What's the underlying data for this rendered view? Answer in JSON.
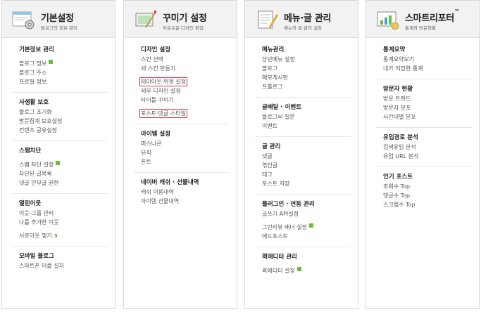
{
  "columns": [
    {
      "title": "기본설정",
      "subtitle": "블로그의 정보 관리",
      "icon": "gear-window-icon",
      "sections": [
        {
          "title": "기본정보 관리",
          "items": [
            {
              "label": "블로그 정보",
              "badge": "new"
            },
            {
              "label": "블로그 주소"
            },
            {
              "label": "프로필 정보"
            }
          ]
        },
        {
          "title": "사생활 보호",
          "items": [
            {
              "label": "블로그 초기화"
            },
            {
              "label": "방문집계 보호설정"
            },
            {
              "label": "컨텐츠 공유설정"
            }
          ]
        },
        {
          "title": "스팸차단",
          "items": [
            {
              "label": "스팸 차단 설정",
              "badge": "new"
            },
            {
              "label": "차단된 글목록"
            },
            {
              "label": "댓글 안부글 권한"
            }
          ]
        },
        {
          "title": "열린이웃",
          "items": [
            {
              "label": "이웃·그룹 관리"
            },
            {
              "label": "나를 추가한 이웃"
            },
            {
              "label": "서로이웃 맺기",
              "count": "3"
            }
          ]
        },
        {
          "title": "모바일 블로그",
          "items": [
            {
              "label": "스마트폰 어플 설치"
            }
          ]
        }
      ]
    },
    {
      "title": "꾸미기 설정",
      "subtitle": "자유로운 디자인 편집",
      "icon": "paint-canvas-icon",
      "sections": [
        {
          "title": "디자인 설정",
          "items": [
            {
              "label": "스킨 선택"
            },
            {
              "label": "새 스킨 만들기"
            },
            {
              "label": "레이아웃·위젯 설정",
              "highlight": true
            },
            {
              "label": "세부 디자인 설정"
            },
            {
              "label": "타이틀 꾸미기"
            },
            {
              "label": "포스트·댓글 스타일",
              "highlight": true
            }
          ]
        },
        {
          "title": "아이템 설정",
          "items": [
            {
              "label": "퍼스나콘"
            },
            {
              "label": "뮤직"
            },
            {
              "label": "폰트"
            }
          ]
        },
        {
          "title": "네이버 캐쉬 · 선물내역",
          "items": [
            {
              "label": "캐쉬 이용내역"
            },
            {
              "label": "아이템 선물내역"
            }
          ]
        }
      ]
    },
    {
      "title": "메뉴·글 관리",
      "subtitle": "메뉴와 글 관리 설정",
      "icon": "notepad-pencil-icon",
      "sections": [
        {
          "title": "메뉴관리",
          "items": [
            {
              "label": "상단메뉴 설정"
            },
            {
              "label": "블로그"
            },
            {
              "label": "메모게시판"
            },
            {
              "label": "프롤로그"
            }
          ]
        },
        {
          "title": "글배달 · 이벤트",
          "items": [
            {
              "label": "블로그씨 질문"
            },
            {
              "label": "이벤트"
            }
          ]
        },
        {
          "title": "글 관리",
          "items": [
            {
              "label": "댓글"
            },
            {
              "label": "엮인글"
            },
            {
              "label": "태그"
            },
            {
              "label": "포스트 저장"
            }
          ]
        },
        {
          "title": "플러그인 · 연동 관리",
          "items": [
            {
              "label": "글쓰기 API설정"
            },
            {
              "label": "그린리뷰 배너 설정",
              "badge": "new"
            },
            {
              "label": "애드포스트"
            }
          ]
        },
        {
          "title": "퀵에디터 관리",
          "items": [
            {
              "label": "퀵에디터 설정",
              "badge": "new"
            }
          ]
        }
      ]
    },
    {
      "title": "스마트리포터",
      "title_mark": "™",
      "subtitle": "통계와 방문현황",
      "icon": "chart-board-icon",
      "sections": [
        {
          "title": "통계요약",
          "items": [
            {
              "label": "통계요약보기"
            },
            {
              "label": "내가 저장한 통계"
            }
          ]
        },
        {
          "title": "방문자 현황",
          "items": [
            {
              "label": "방문 트렌드"
            },
            {
              "label": "방문자 분포"
            },
            {
              "label": "시간대별 분포"
            }
          ]
        },
        {
          "title": "유입경로 분석",
          "items": [
            {
              "label": "검색유입 분석"
            },
            {
              "label": "유입 URL 분석"
            }
          ]
        },
        {
          "title": "인기 포스트",
          "items": [
            {
              "label": "조회수 Top"
            },
            {
              "label": "댓글수 Top"
            },
            {
              "label": "스크랩수 Top"
            }
          ]
        }
      ]
    }
  ],
  "colors": {
    "highlight_border": "#d9363e",
    "badge_green": "#6abf3a",
    "header_bg": "#f2f2f2"
  }
}
